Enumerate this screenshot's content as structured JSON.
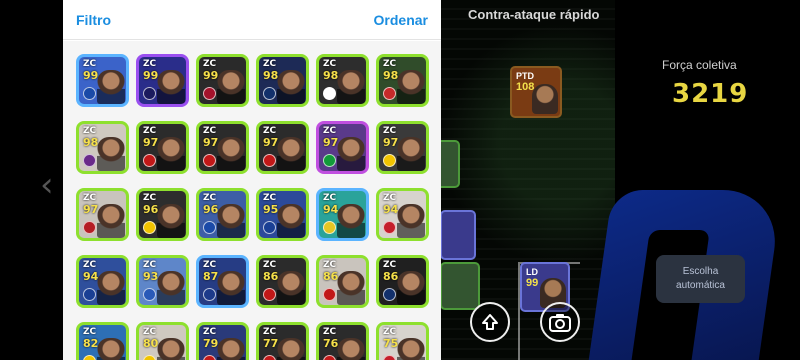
{
  "panel": {
    "filter_label": "Filtro",
    "sort_label": "Ordenar"
  },
  "tactic": {
    "name": "Contra-ataque rápido"
  },
  "team_strength": {
    "label": "Força coletiva",
    "value": "3219"
  },
  "auto_select": {
    "label": "Escolha automática"
  },
  "field_cards": [
    {
      "pos": "PTD",
      "rating": "108"
    },
    {
      "pos": "LD",
      "rating": "99"
    }
  ],
  "cards": [
    {
      "pos": "ZC",
      "rating": "99",
      "border": "#5bb4ff",
      "bg": "#3b63c9",
      "badge": "#1a4aa8"
    },
    {
      "pos": "ZC",
      "rating": "99",
      "border": "#9a4ff0",
      "bg": "#2a2d8a",
      "badge": "#1b1b5e"
    },
    {
      "pos": "ZC",
      "rating": "99",
      "border": "#8ee02e",
      "bg": "#2a2a2a",
      "badge": "#a4122b"
    },
    {
      "pos": "ZC",
      "rating": "98",
      "border": "#8ee02e",
      "bg": "#1d2a56",
      "badge": "#12306b"
    },
    {
      "pos": "ZC",
      "rating": "98",
      "border": "#8ee02e",
      "bg": "#2d2d2d",
      "badge": "#ffffff"
    },
    {
      "pos": "ZC",
      "rating": "98",
      "border": "#8ee02e",
      "bg": "#304c2a",
      "badge": "#c62a2a"
    },
    {
      "pos": "ZC",
      "rating": "98",
      "border": "#8ee02e",
      "bg": "#cfc9c0",
      "badge": "#6a2a8a"
    },
    {
      "pos": "ZC",
      "rating": "97",
      "border": "#8ee02e",
      "bg": "#2b2b2b",
      "badge": "#c11818"
    },
    {
      "pos": "ZC",
      "rating": "97",
      "border": "#8ee02e",
      "bg": "#2b2b2b",
      "badge": "#c11818"
    },
    {
      "pos": "ZC",
      "rating": "97",
      "border": "#8ee02e",
      "bg": "#2b2b2b",
      "badge": "#c11818"
    },
    {
      "pos": "ZC",
      "rating": "97",
      "border": "#c04fe0",
      "bg": "#5a3a8a",
      "badge": "#129a3a"
    },
    {
      "pos": "ZC",
      "rating": "97",
      "border": "#8ee02e",
      "bg": "#3a3a3a",
      "badge": "#f1c400"
    },
    {
      "pos": "ZC",
      "rating": "97",
      "border": "#8ee02e",
      "bg": "#c9c4bd",
      "badge": "#b51d25"
    },
    {
      "pos": "ZC",
      "rating": "96",
      "border": "#8ee02e",
      "bg": "#2d2d2d",
      "badge": "#f1c400"
    },
    {
      "pos": "ZC",
      "rating": "96",
      "border": "#8ee02e",
      "bg": "#3d5ea6",
      "badge": "#1a4aa8"
    },
    {
      "pos": "ZC",
      "rating": "95",
      "border": "#8ee02e",
      "bg": "#2c4a9a",
      "badge": "#1a3f94"
    },
    {
      "pos": "ZC",
      "rating": "94",
      "border": "#5bb4ff",
      "bg": "#2aa39a",
      "badge": "#e5c623"
    },
    {
      "pos": "ZC",
      "rating": "94",
      "border": "#8ee02e",
      "bg": "#d7d3cd",
      "badge": "#c51e2a"
    },
    {
      "pos": "ZC",
      "rating": "94",
      "border": "#8ee02e",
      "bg": "#2f4f9c",
      "badge": "#1a3f94"
    },
    {
      "pos": "ZC",
      "rating": "93",
      "border": "#8ee02e",
      "bg": "#5e86c9",
      "badge": "#2a5ab8"
    },
    {
      "pos": "ZC",
      "rating": "87",
      "border": "#5bb4ff",
      "bg": "#263c84",
      "badge": "#1d3a8a"
    },
    {
      "pos": "ZC",
      "rating": "86",
      "border": "#8ee02e",
      "bg": "#2b2b2b",
      "badge": "#c11818"
    },
    {
      "pos": "ZC",
      "rating": "86",
      "border": "#8ee02e",
      "bg": "#c9c4bd",
      "badge": "#c11818"
    },
    {
      "pos": "ZC",
      "rating": "86",
      "border": "#8ee02e",
      "bg": "#202020",
      "badge": "#12306b"
    },
    {
      "pos": "ZC",
      "rating": "82",
      "border": "#8ee02e",
      "bg": "#2d6fb5",
      "badge": "#f1c400"
    },
    {
      "pos": "ZC",
      "rating": "80",
      "border": "#8ee02e",
      "bg": "#cfc9c0",
      "badge": "#f1c400"
    },
    {
      "pos": "ZC",
      "rating": "79",
      "border": "#8ee02e",
      "bg": "#2a3a7a",
      "badge": "#c11818"
    },
    {
      "pos": "ZC",
      "rating": "77",
      "border": "#8ee02e",
      "bg": "#2b2b2b",
      "badge": "#c11818"
    },
    {
      "pos": "ZC",
      "rating": "76",
      "border": "#8ee02e",
      "bg": "#2b2b2b",
      "badge": "#c11818"
    },
    {
      "pos": "ZC",
      "rating": "75",
      "border": "#8ee02e",
      "bg": "#d7d3cd",
      "badge": "#c51e2a"
    }
  ]
}
